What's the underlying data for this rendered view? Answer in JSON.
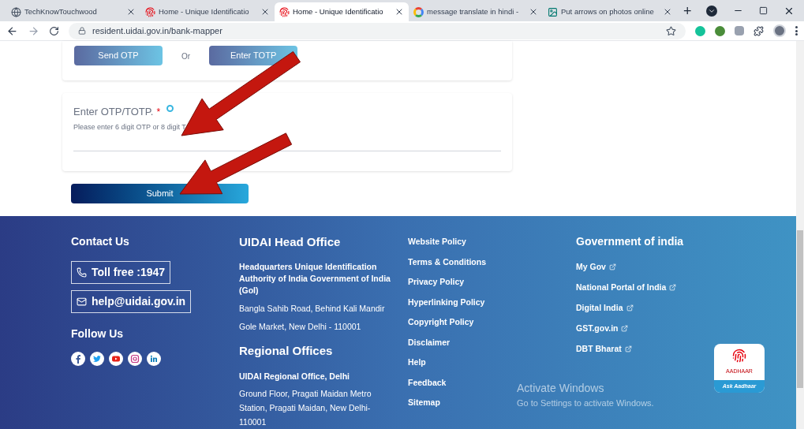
{
  "browser": {
    "tabs": [
      {
        "title": "TechKnowTouchwood",
        "selected": false
      },
      {
        "title": "Home - Unique Identificatio",
        "selected": false
      },
      {
        "title": "Home - Unique Identificatio",
        "selected": true
      },
      {
        "title": "message translate in hindi -",
        "selected": false
      },
      {
        "title": "Put arrows on photos online",
        "selected": false
      }
    ],
    "new_tab": "+",
    "address": "resident.uidai.gov.in/bank-mapper"
  },
  "form": {
    "otp_buttons": [
      "Send OTP",
      "Enter TOTP"
    ],
    "separator": "Or",
    "otp_field": {
      "label": "Enter OTP/TOTP.",
      "required_mark": "*",
      "hint": "Please enter 6 digit OTP or 8 digit T"
    },
    "submit": "Submit"
  },
  "footer": {
    "contact": {
      "title": "Contact Us",
      "phone": "Toll free :1947",
      "email": "help@uidai.gov.in",
      "follow_title": "Follow Us"
    },
    "head_office": {
      "title": "UIDAI Head Office",
      "lines": [
        {
          "text": "Headquarters Unique Identification Authority of India Government of India (GoI)",
          "bold": true
        },
        {
          "text": "Bangla Sahib Road, Behind Kali Mandir",
          "bold": false
        },
        {
          "text": "Gole Market, New Delhi - 110001",
          "bold": false
        }
      ]
    },
    "regional": {
      "title": "Regional Offices",
      "lines": [
        {
          "text": "UIDAI Regional Office, Delhi",
          "bold": true
        },
        {
          "text": "Ground Floor, Pragati Maidan Metro Station, Pragati Maidan, New Delhi-110001",
          "bold": false
        }
      ]
    },
    "policy_links": [
      "Website Policy",
      "Terms & Conditions",
      "Privacy Policy",
      "Hyperlinking Policy",
      "Copyright Policy",
      "Disclaimer",
      "Help",
      "Feedback",
      "Sitemap"
    ],
    "gov": {
      "title": "Government of india",
      "links": [
        "My Gov",
        "National Portal of India",
        "Digital India",
        "GST.gov.in",
        "DBT Bharat"
      ]
    },
    "ask_badge": {
      "brand": "AADHAAR",
      "label": "Ask Aadhaar"
    }
  },
  "os_notice": {
    "title": "Activate Windows",
    "text": "Go to Settings to activate Windows."
  }
}
